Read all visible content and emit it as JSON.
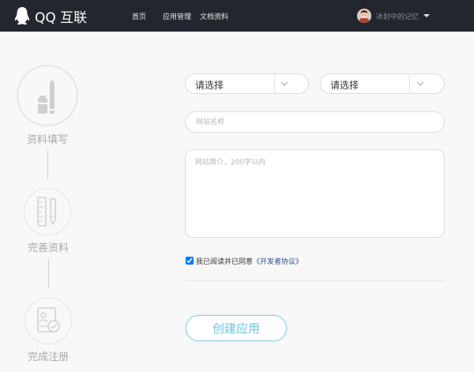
{
  "header": {
    "logo_text": "QQ 互联",
    "nav": [
      {
        "label": "首页"
      },
      {
        "label": "应用管理"
      },
      {
        "label": "文档资料"
      }
    ],
    "user": {
      "name": "冰封中的记忆"
    }
  },
  "steps": [
    {
      "label": "资料填写",
      "active": true
    },
    {
      "label": "完善资料",
      "active": false
    },
    {
      "label": "完成注册",
      "active": false
    }
  ],
  "form": {
    "select_1": {
      "value": "请选择"
    },
    "select_2": {
      "value": "请选择"
    },
    "site_name": {
      "placeholder": "网站名称",
      "value": ""
    },
    "site_desc": {
      "placeholder": "网站简介，200字以内",
      "value": ""
    },
    "agreement": {
      "prefix": "我已阅读并已同意",
      "link": "《开发者协议》",
      "checked": true
    },
    "submit_label": "创建应用"
  },
  "colors": {
    "header_bg": "#23262e",
    "page_bg": "#f8f8f8",
    "button_accent": "#6fc3e0",
    "link": "#2c4a87"
  }
}
